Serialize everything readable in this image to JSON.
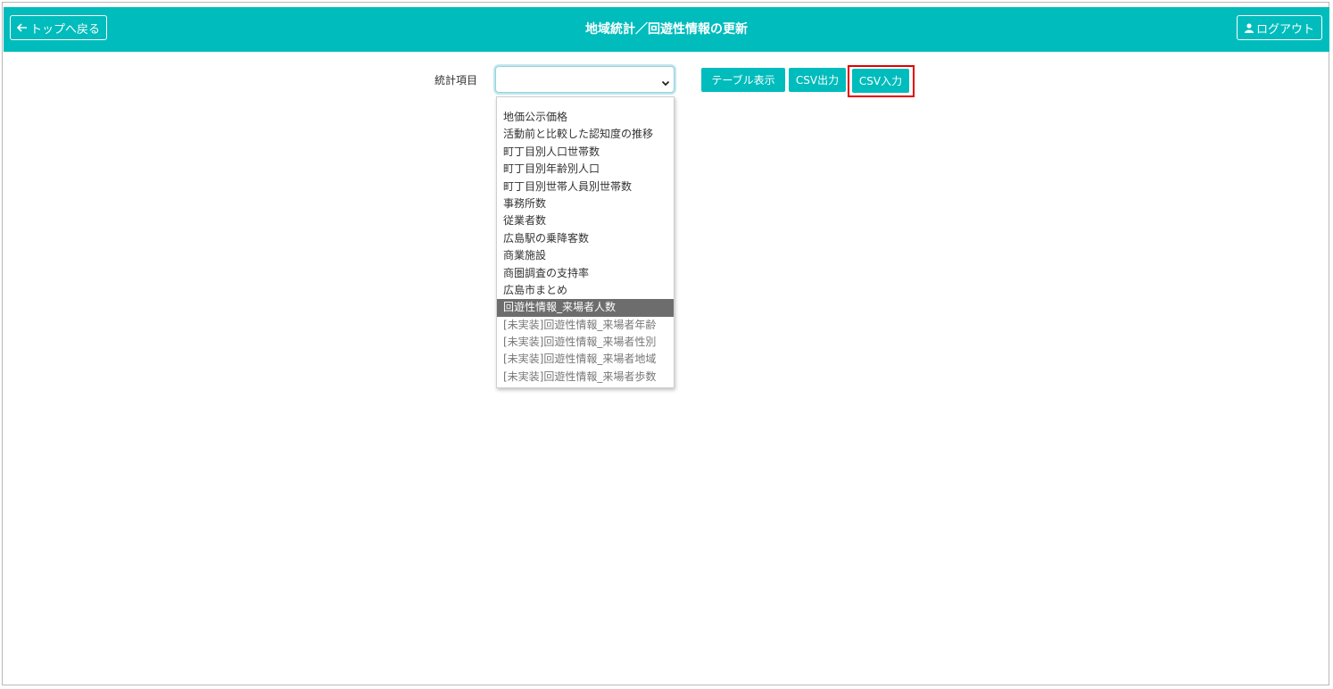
{
  "header": {
    "title": "地域統計／回遊性情報の更新",
    "back_label": "トップへ戻る",
    "logout_label": "ログアウト",
    "color": "#00bcbc"
  },
  "form": {
    "field_label": "統計項目",
    "select_value": "",
    "buttons": {
      "table": "テーブル表示",
      "csv_out": "CSV出力",
      "csv_in": "CSV入力"
    }
  },
  "dropdown": {
    "options": [
      "地価公示価格",
      "活動前と比較した認知度の推移",
      "町丁目別人口世帯数",
      "町丁目別年齢別人口",
      "町丁目別世帯人員別世帯数",
      "事務所数",
      "従業者数",
      "広島駅の乗降客数",
      "商業施設",
      "商圏調査の支持率",
      "広島市まとめ",
      "回遊性情報_来場者人数",
      "[未実装]回遊性情報_来場者年齢",
      "[未実装]回遊性情報_来場者性別",
      "[未実装]回遊性情報_来場者地域",
      "[未実装]回遊性情報_来場者歩数"
    ],
    "selected_index": 11,
    "highlight_color": "#6d6d6d"
  },
  "icons": {
    "back": "arrow-left-icon",
    "logout": "user-icon",
    "select": "chevron-down-icon"
  },
  "annotation": {
    "highlight_color": "#e00000",
    "target": "CSV入力"
  }
}
